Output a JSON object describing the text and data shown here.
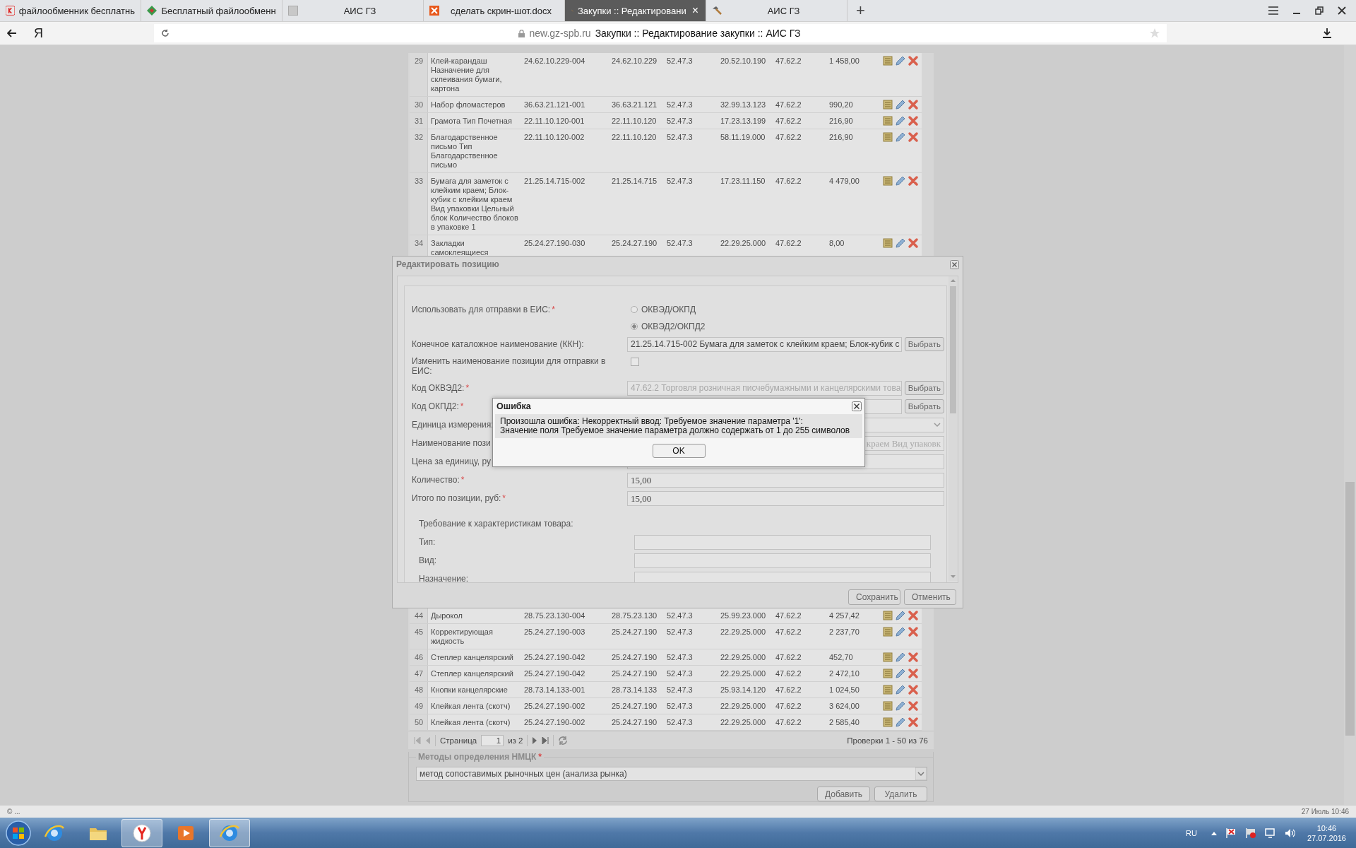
{
  "browser": {
    "tabs": [
      {
        "title": "файлообменник бесплатнь",
        "selected": false,
        "kind": "yandex"
      },
      {
        "title": "Бесплатный файлообменн",
        "selected": false,
        "kind": "diamond"
      },
      {
        "title": "АИС ГЗ",
        "selected": false,
        "kind": "blank"
      },
      {
        "title": "сделать скрин-шот.docx",
        "selected": false,
        "kind": "office"
      },
      {
        "title": "Закупки :: Редактировани",
        "selected": true,
        "kind": "hammer",
        "close": "×"
      },
      {
        "title": "АИС ГЗ",
        "selected": false,
        "kind": "hammer"
      }
    ],
    "new_tab": "+",
    "yandex_button": "Я",
    "address_bar": {
      "domain": "new.gz-spb.ru",
      "title": "Закупки :: Редактирование закупки :: АИС ГЗ"
    }
  },
  "items_table": {
    "rows_above": [
      {
        "cells": [
          "29",
          "Клей-карандаш Назначение для склеивания бумаги, картона",
          "24.62.10.229-004",
          "24.62.10.229",
          "52.47.3",
          "20.52.10.190",
          "47.62.2",
          "1 458,00"
        ]
      },
      {
        "cells": [
          "30",
          "Набор фломастеров",
          "36.63.21.121-001",
          "36.63.21.121",
          "52.47.3",
          "32.99.13.123",
          "47.62.2",
          "990,20"
        ]
      },
      {
        "cells": [
          "31",
          "Грамота Тип Почетная",
          "22.11.10.120-001",
          "22.11.10.120",
          "52.47.3",
          "17.23.13.199",
          "47.62.2",
          "216,90"
        ]
      },
      {
        "cells": [
          "32",
          "Благодарственное письмо Тип Благодарственное письмо",
          "22.11.10.120-002",
          "22.11.10.120",
          "52.47.3",
          "58.11.19.000",
          "47.62.2",
          "216,90"
        ]
      },
      {
        "cells": [
          "33",
          "Бумага для заметок с клейким краем; Блок-кубик с клейким краем Вид упаковки Цельный блок Количество блоков в упаковке 1",
          "21.25.14.715-002",
          "21.25.14.715",
          "52.47.3",
          "17.23.11.150",
          "47.62.2",
          "4 479,00"
        ]
      },
      {
        "cells": [
          "34",
          "Закладки самоклеящиеся",
          "25.24.27.190-030",
          "25.24.27.190",
          "52.47.3",
          "22.29.25.000",
          "47.62.2",
          "8,00"
        ]
      }
    ],
    "rows_below": [
      {
        "cells": [
          "44",
          "Дырокол",
          "28.75.23.130-004",
          "28.75.23.130",
          "52.47.3",
          "25.99.23.000",
          "47.62.2",
          "4 257,42"
        ]
      },
      {
        "cells": [
          "45",
          "Корректирующая жидкость",
          "25.24.27.190-003",
          "25.24.27.190",
          "52.47.3",
          "22.29.25.000",
          "47.62.2",
          "2 237,70"
        ]
      },
      {
        "cells": [
          "46",
          "Степлер канцелярский",
          "25.24.27.190-042",
          "25.24.27.190",
          "52.47.3",
          "22.29.25.000",
          "47.62.2",
          "452,70"
        ]
      },
      {
        "cells": [
          "47",
          "Степлер канцелярский",
          "25.24.27.190-042",
          "25.24.27.190",
          "52.47.3",
          "22.29.25.000",
          "47.62.2",
          "2 472,10"
        ]
      },
      {
        "cells": [
          "48",
          "Кнопки канцелярские",
          "28.73.14.133-001",
          "28.73.14.133",
          "52.47.3",
          "25.93.14.120",
          "47.62.2",
          "1 024,50"
        ]
      },
      {
        "cells": [
          "49",
          "Клейкая лента (скотч)",
          "25.24.27.190-002",
          "25.24.27.190",
          "52.47.3",
          "22.29.25.000",
          "47.62.2",
          "3 624,00"
        ]
      },
      {
        "cells": [
          "50",
          "Клейкая лента (скотч)",
          "25.24.27.190-002",
          "25.24.27.190",
          "52.47.3",
          "22.29.25.000",
          "47.62.2",
          "2 585,40"
        ]
      }
    ],
    "pager": {
      "label": "Страница",
      "page": "1",
      "total": "из 2",
      "summary": "Проверки 1 - 50 из 76"
    }
  },
  "pricing_methods": {
    "legend": "Методы определения НМЦК",
    "mark": "*",
    "value": "метод сопоставимых рыночных цен (анализа рынка)",
    "buttons": [
      "Добавить",
      "Удалить"
    ]
  },
  "edit_dialog": {
    "title": "Редактировать позицию",
    "fields": [
      {
        "kind": "radio",
        "label": "Использовать для отправки в ЕИС:",
        "mark": "*",
        "options": [
          {
            "label": "ОКВЭД/ОКПД",
            "selected": false
          },
          {
            "label": "ОКВЭД2/ОКПД2",
            "selected": true
          }
        ]
      },
      {
        "kind": "picker",
        "label": "Конечное каталожное наименование (ККН):",
        "value": "21.25.14.715-002 Бумага для заметок с клейким краем; Блок-кубик с",
        "disabled": false,
        "button": "Выбрать"
      },
      {
        "kind": "checkbox",
        "label": "Изменить наименование позиции для отправки в ЕИС:",
        "checked": false
      },
      {
        "kind": "picker",
        "label": "Код ОКВЭД2:",
        "mark": "*",
        "value": "47.62.2 Торговля розничная писчебумажными и канцелярскими това",
        "disabled": true,
        "button": "Выбрать"
      },
      {
        "kind": "picker",
        "label": "Код ОКПД2:",
        "mark": "*",
        "button": "Выбрать"
      },
      {
        "kind": "select",
        "label": "Единица измерения:"
      },
      {
        "kind": "input",
        "label": "Наименование пози",
        "value": "краем Вид упаковк",
        "disabled": true,
        "scrolled": true
      },
      {
        "kind": "input",
        "label": "Цена за единицу, ру"
      },
      {
        "kind": "input",
        "label": "Количество:",
        "mark": "*",
        "value": "15,00",
        "disabled": false
      },
      {
        "kind": "input",
        "label": "Итого по позиции, руб:",
        "mark": "*",
        "value": "15,00",
        "disabled": false
      }
    ],
    "characteristics": {
      "title": "Требование к характеристикам товара:",
      "fields": [
        {
          "label": "Тип:"
        },
        {
          "label": "Вид:"
        },
        {
          "label": "Назначение:"
        }
      ]
    },
    "buttons": [
      "Сохранить",
      "Отменить"
    ]
  },
  "error_dialog": {
    "title": "Ошибка",
    "message_lines": [
      "Произошла ошибка: Некорректный ввод: Требуемое значение параметра '1':",
      "Значение поля Требуемое значение параметра должно содержать от 1 до 255 символов"
    ],
    "button": "OK"
  },
  "status_bar": {
    "left": "© ...",
    "right": "27 Июль 10:46"
  },
  "taskbar": {
    "apps": [
      {
        "kind": "ie",
        "selected": false
      },
      {
        "kind": "folder",
        "selected": false
      },
      {
        "kind": "yandex",
        "selected": true
      },
      {
        "kind": "media",
        "selected": false
      },
      {
        "kind": "ie",
        "selected": true
      }
    ],
    "tray": {
      "language": "RU",
      "time": "10:46",
      "date": "27.07.2016"
    }
  }
}
